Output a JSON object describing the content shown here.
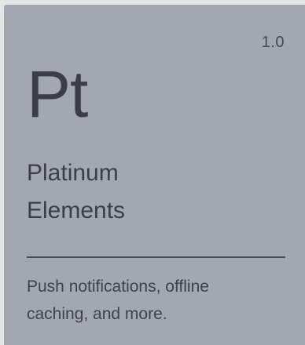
{
  "card": {
    "version": "1.0",
    "symbol": "Pt",
    "name_lines": [
      "Platinum",
      "Elements"
    ],
    "description_lines": [
      "Push notifications, offline",
      "caching, and more."
    ]
  },
  "colors": {
    "card_background": "#a2a7b2",
    "page_background": "#e4e5e8",
    "text": "#3b3e45"
  }
}
